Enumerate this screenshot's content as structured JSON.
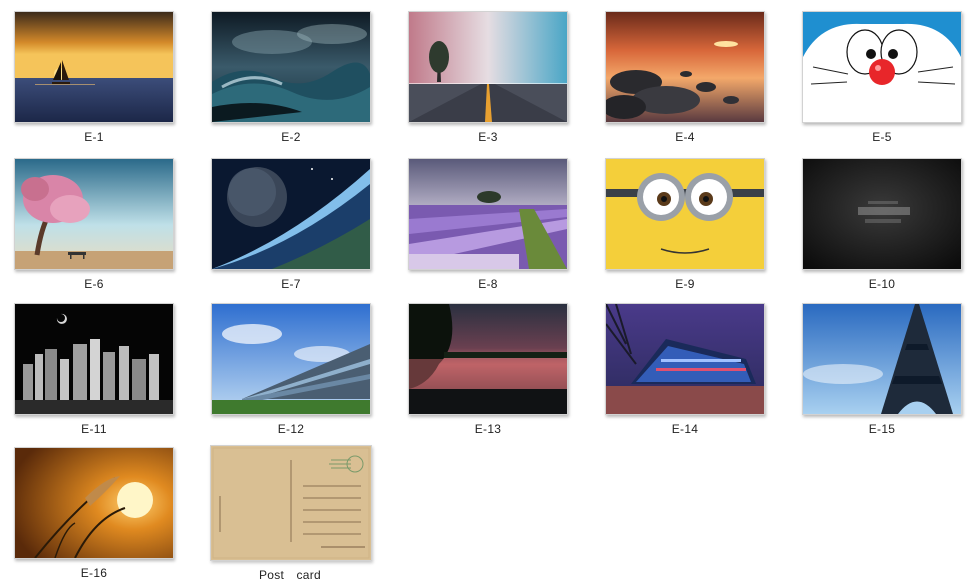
{
  "gallery": {
    "items": [
      {
        "label": "E-1"
      },
      {
        "label": "E-2"
      },
      {
        "label": "E-3"
      },
      {
        "label": "E-4"
      },
      {
        "label": "E-5"
      },
      {
        "label": "E-6"
      },
      {
        "label": "E-7"
      },
      {
        "label": "E-8"
      },
      {
        "label": "E-9"
      },
      {
        "label": "E-10"
      },
      {
        "label": "E-11"
      },
      {
        "label": "E-12"
      },
      {
        "label": "E-13"
      },
      {
        "label": "E-14"
      },
      {
        "label": "E-15"
      },
      {
        "label": "E-16"
      },
      {
        "label": "Post　card"
      }
    ]
  }
}
